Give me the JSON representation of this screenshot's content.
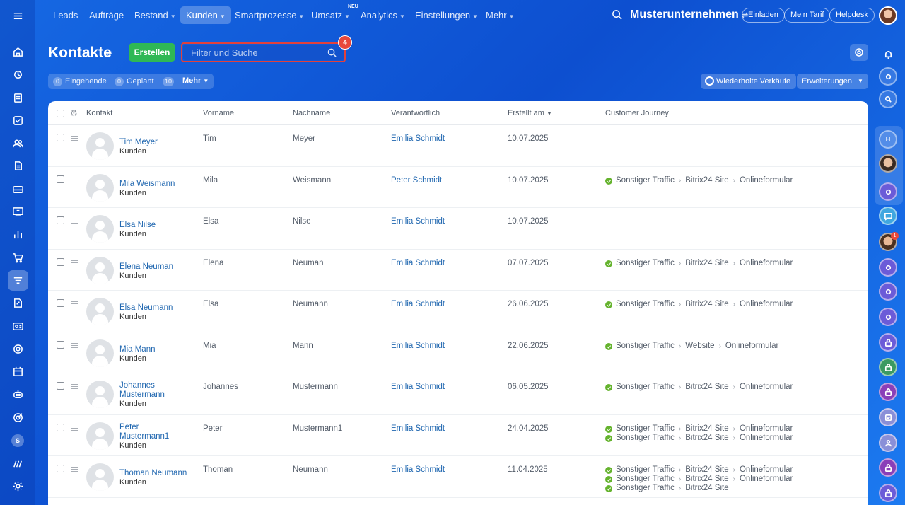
{
  "topnav": {
    "items": [
      {
        "label": "Leads"
      },
      {
        "label": "Aufträge"
      },
      {
        "label": "Bestand"
      },
      {
        "label": "Kunden"
      },
      {
        "label": "Smartprozesse"
      },
      {
        "label": "Umsatz"
      },
      {
        "label": "Analytics"
      },
      {
        "label": "Einstellungen"
      },
      {
        "label": "Mehr"
      }
    ],
    "neu_badge": "NEU",
    "company": "Musterunternehmen",
    "invite": "Einladen",
    "plan": "Mein Tarif",
    "helpdesk": "Helpdesk"
  },
  "header": {
    "title": "Kontakte",
    "create_label": "Erstellen",
    "search_placeholder": "Filter und Suche",
    "step_badge": "4"
  },
  "counters": {
    "incoming_count": "0",
    "incoming_label": "Eingehende",
    "planned_count": "0",
    "planned_label": "Geplant",
    "more_count": "10",
    "more_label": "Mehr"
  },
  "toolbar": {
    "repeat_sales": "Wiederholte Verkäufe",
    "extensions": "Erweiterungen"
  },
  "table": {
    "columns": {
      "contact": "Kontakt",
      "firstname": "Vorname",
      "lastname": "Nachname",
      "responsible": "Verantwortlich",
      "created": "Erstellt am",
      "journey": "Customer Journey"
    },
    "rows": [
      {
        "name": "Tim Meyer",
        "type": "Kunden",
        "first": "Tim",
        "last": "Meyer",
        "resp": "Emilia Schmidt",
        "date": "10.07.2025",
        "journey": []
      },
      {
        "name": "Mila Weismann",
        "type": "Kunden",
        "first": "Mila",
        "last": "Weismann",
        "resp": "Peter Schmidt",
        "date": "10.07.2025",
        "journey": [
          [
            "Sonstiger Traffic",
            "Bitrix24 Site",
            "Onlineformular"
          ]
        ]
      },
      {
        "name": "Elsa Nilse",
        "type": "Kunden",
        "first": "Elsa",
        "last": "Nilse",
        "resp": "Emilia Schmidt",
        "date": "10.07.2025",
        "journey": []
      },
      {
        "name": "Elena Neuman",
        "type": "Kunden",
        "first": "Elena",
        "last": "Neuman",
        "resp": "Emilia Schmidt",
        "date": "07.07.2025",
        "journey": [
          [
            "Sonstiger Traffic",
            "Bitrix24 Site",
            "Onlineformular"
          ]
        ]
      },
      {
        "name": "Elsa Neumann",
        "type": "Kunden",
        "first": "Elsa",
        "last": "Neumann",
        "resp": "Emilia Schmidt",
        "date": "26.06.2025",
        "journey": [
          [
            "Sonstiger Traffic",
            "Bitrix24 Site",
            "Onlineformular"
          ]
        ]
      },
      {
        "name": "Mia Mann",
        "type": "Kunden",
        "first": "Mia",
        "last": "Mann",
        "resp": "Emilia Schmidt",
        "date": "22.06.2025",
        "journey": [
          [
            "Sonstiger Traffic",
            "Website",
            "Onlineformular"
          ]
        ]
      },
      {
        "name": "Johannes Mustermann",
        "type": "Kunden",
        "first": "Johannes",
        "last": "Mustermann",
        "resp": "Emilia Schmidt",
        "date": "06.05.2025",
        "journey": [
          [
            "Sonstiger Traffic",
            "Bitrix24 Site",
            "Onlineformular"
          ]
        ]
      },
      {
        "name": "Peter Mustermann1",
        "type": "Kunden",
        "first": "Peter",
        "last": "Mustermann1",
        "resp": "Emilia Schmidt",
        "date": "24.04.2025",
        "journey": [
          [
            "Sonstiger Traffic",
            "Bitrix24 Site",
            "Onlineformular"
          ],
          [
            "Sonstiger Traffic",
            "Bitrix24 Site",
            "Onlineformular"
          ]
        ]
      },
      {
        "name": "Thoman Neumann",
        "type": "Kunden",
        "first": "Thoman",
        "last": "Neumann",
        "resp": "Emilia Schmidt",
        "date": "11.04.2025",
        "journey": [
          [
            "Sonstiger Traffic",
            "Bitrix24 Site",
            "Onlineformular"
          ],
          [
            "Sonstiger Traffic",
            "Bitrix24 Site",
            "Onlineformular"
          ],
          [
            "Sonstiger Traffic",
            "Bitrix24 Site"
          ]
        ]
      }
    ]
  },
  "rightbar": {
    "h_letter": "H",
    "notif_count": "1"
  },
  "leftbar": {
    "s_letter": "S"
  },
  "colors": {
    "accent": "#2fb855",
    "link": "#2067b0",
    "highlight": "#e2413c",
    "journey_dot": "#65b32e"
  }
}
